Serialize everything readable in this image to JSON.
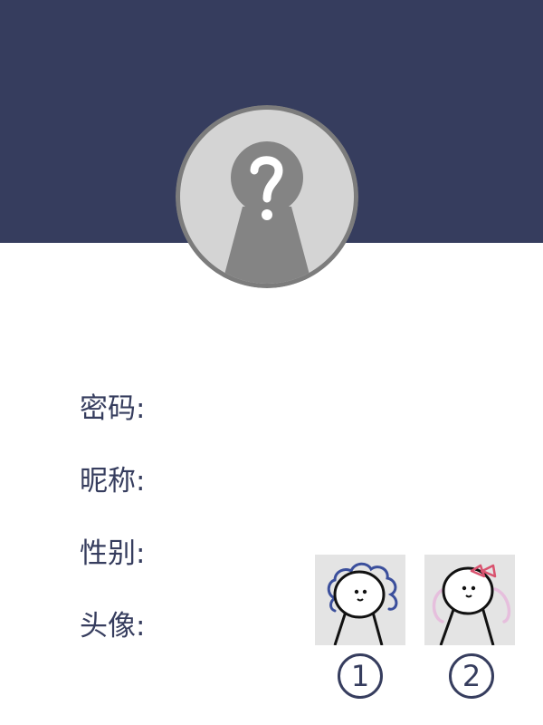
{
  "profile": {
    "avatar_icon": "unknown-user-question-icon"
  },
  "form": {
    "password_label": "密码:",
    "nickname_label": "昵称:",
    "gender_label": "性别:",
    "avatar_label": "头像:"
  },
  "avatar_options": [
    {
      "number": "1",
      "icon": "curly-hair-character-icon"
    },
    {
      "number": "2",
      "icon": "bow-character-icon"
    }
  ],
  "colors": {
    "header": "#363d5e",
    "text": "#363d5e",
    "avatar_bg": "#d4d4d4",
    "avatar_silhouette": "#848484",
    "avatar_border": "#7c7c7c",
    "option_bg": "#e4e4e4",
    "hair_blue": "#3b4f9c",
    "bow_red": "#d9536f",
    "ears_pink": "#e6bfdd"
  }
}
